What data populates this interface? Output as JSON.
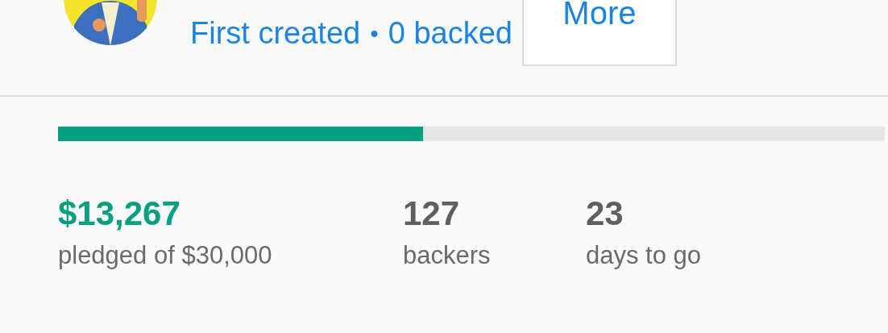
{
  "creator": {
    "avatar": {
      "kind": "picture"
    },
    "links": [
      "First created",
      "0 backed"
    ],
    "separator": "•",
    "button": "More"
  },
  "funding": {
    "level": 0.442
  },
  "stats": [
    {
      "kind": "money",
      "value": "$13,267",
      "label": "pledged of $30,000"
    },
    {
      "kind": "count",
      "value": "127",
      "label": "backers"
    },
    {
      "kind": "count",
      "value": "23",
      "label": "days to go"
    }
  ]
}
